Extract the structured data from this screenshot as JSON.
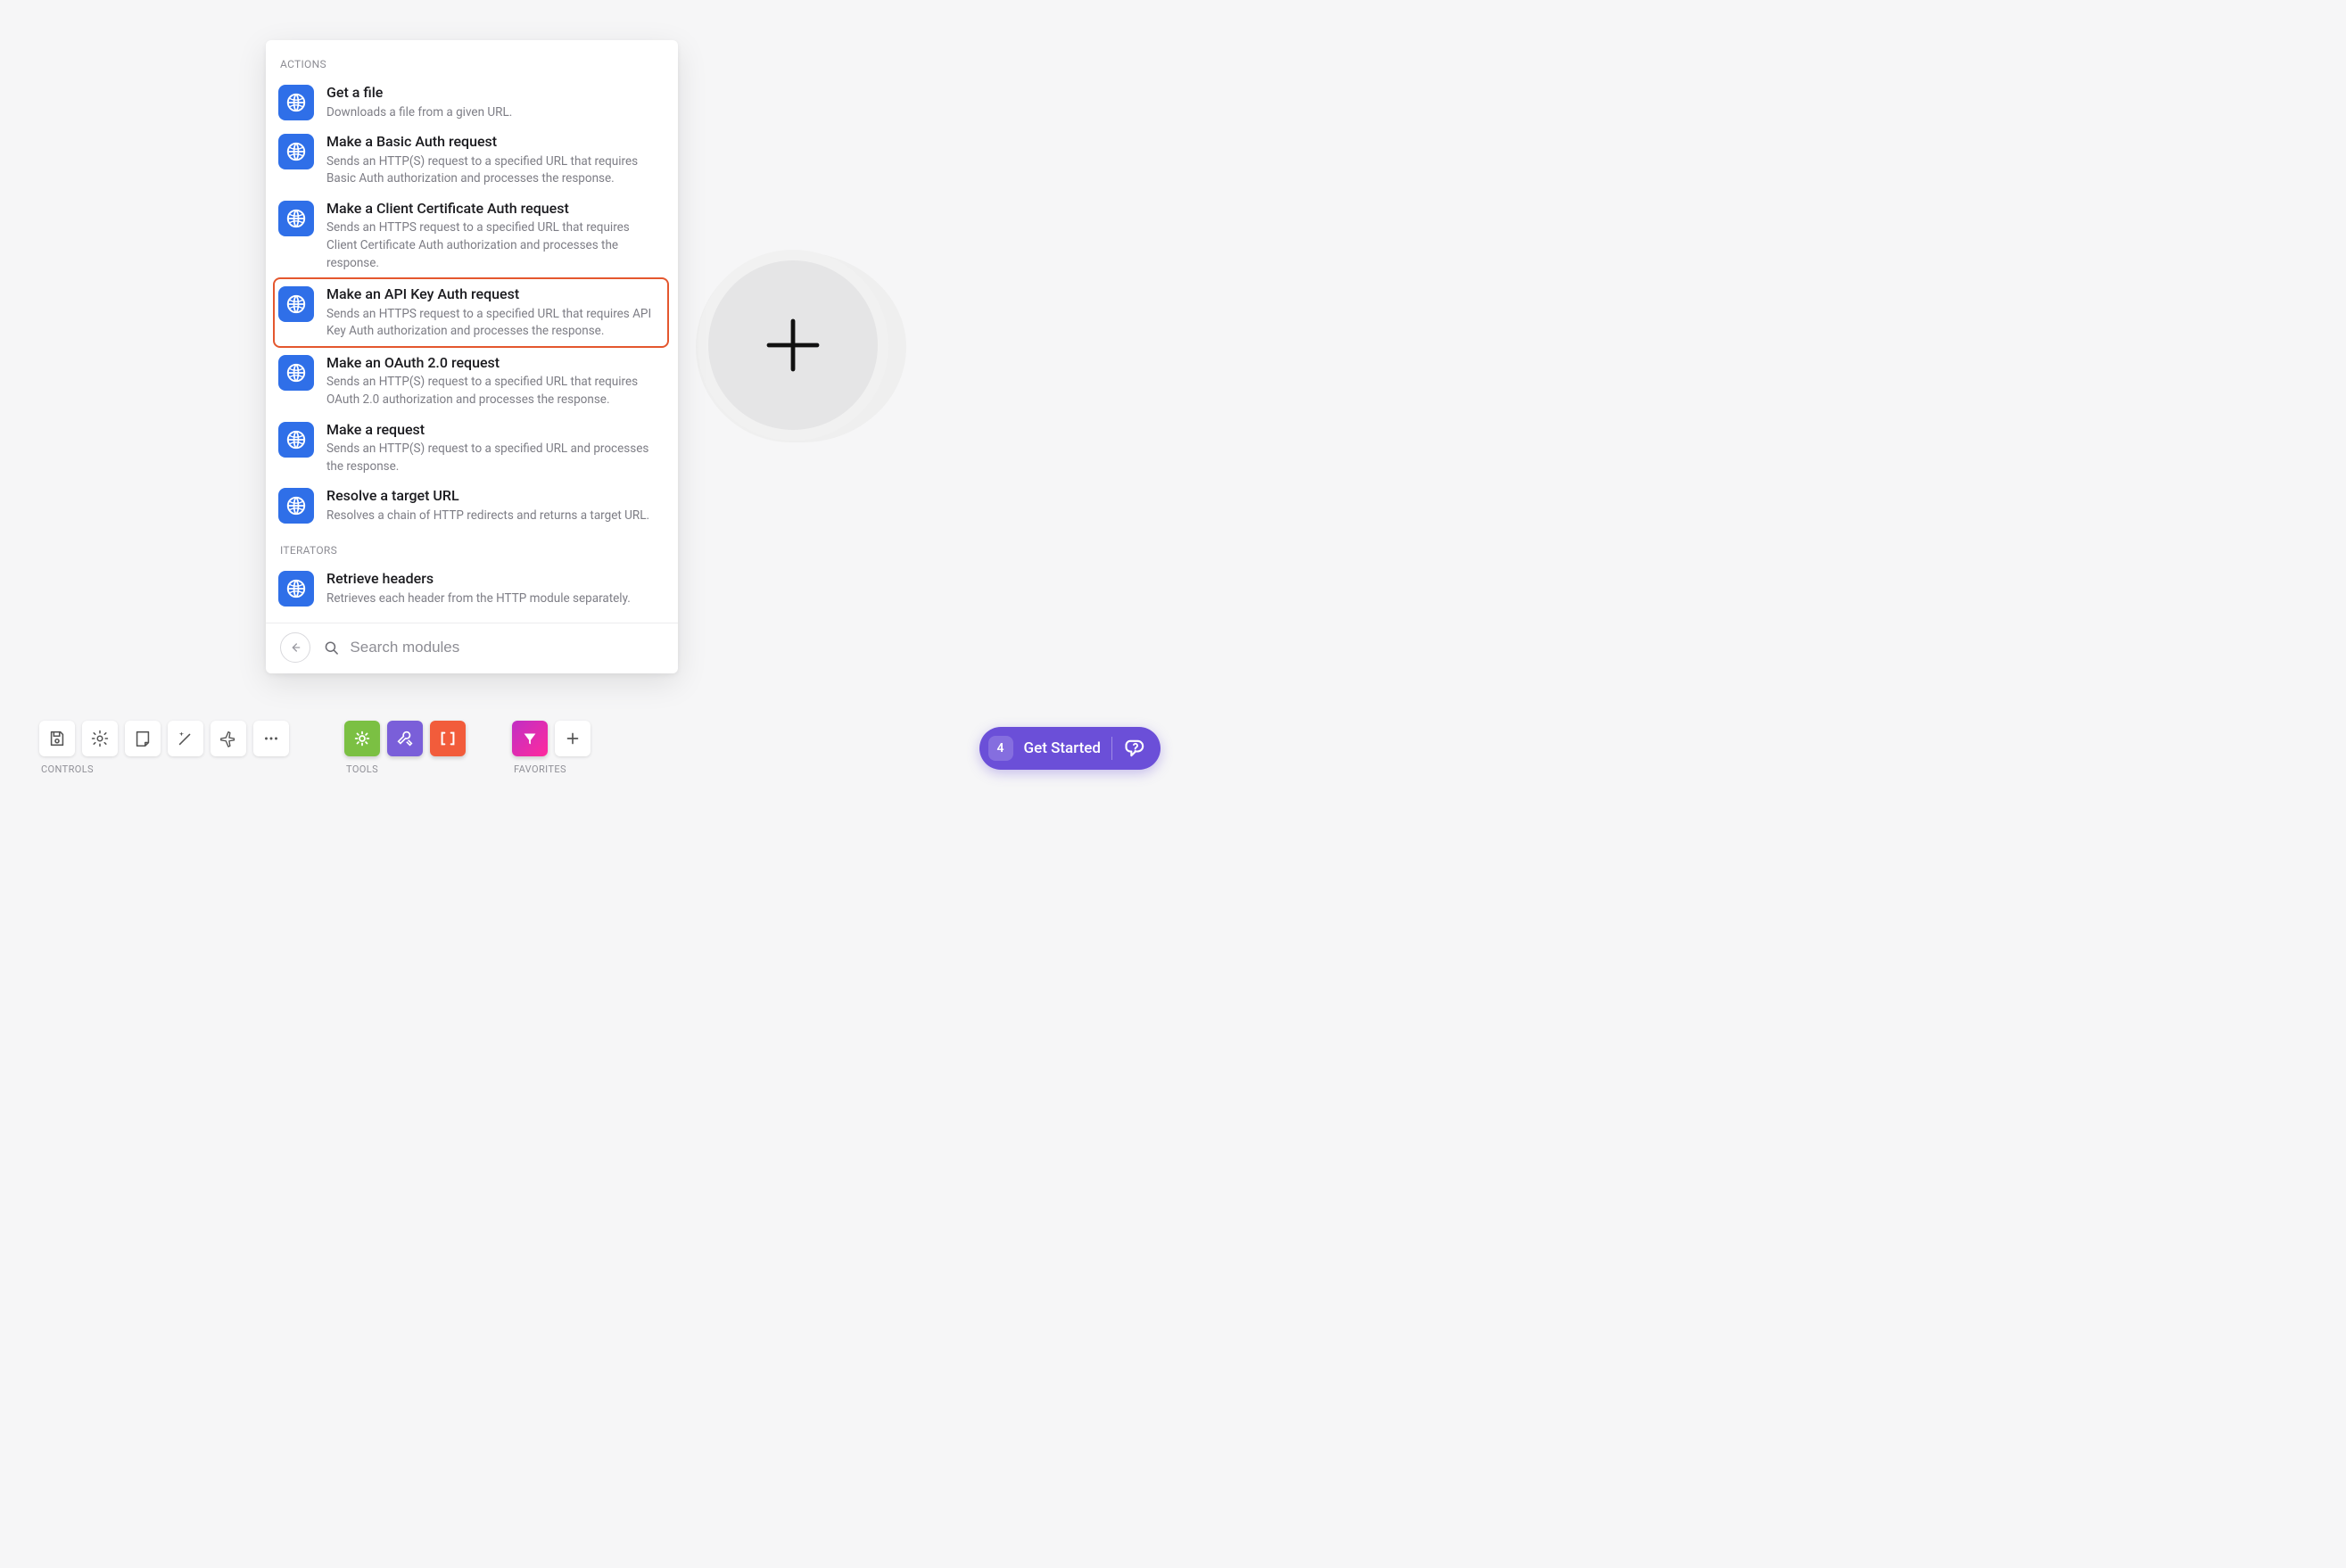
{
  "panel": {
    "sections": [
      {
        "header": "ACTIONS",
        "items": [
          {
            "title": "Get a file",
            "desc": "Downloads a file from a given URL.",
            "name": "action-get-a-file",
            "highlight": false
          },
          {
            "title": "Make a Basic Auth request",
            "desc": "Sends an HTTP(S) request to a specified URL that requires Basic Auth authorization and processes the response.",
            "name": "action-basic-auth-request",
            "highlight": false
          },
          {
            "title": "Make a Client Certificate Auth request",
            "desc": "Sends an HTTPS request to a specified URL that requires Client Certificate Auth authorization and processes the response.",
            "name": "action-client-cert-auth-request",
            "highlight": false
          },
          {
            "title": "Make an API Key Auth request",
            "desc": "Sends an HTTPS request to a specified URL that requires API Key Auth authorization and processes the response.",
            "name": "action-api-key-auth-request",
            "highlight": true
          },
          {
            "title": "Make an OAuth 2.0 request",
            "desc": "Sends an HTTP(S) request to a specified URL that requires OAuth 2.0 authorization and processes the response.",
            "name": "action-oauth2-request",
            "highlight": false
          },
          {
            "title": "Make a request",
            "desc": "Sends an HTTP(S) request to a specified URL and processes the response.",
            "name": "action-make-request",
            "highlight": false
          },
          {
            "title": "Resolve a target URL",
            "desc": "Resolves a chain of HTTP redirects and returns a target URL.",
            "name": "action-resolve-target-url",
            "highlight": false
          }
        ]
      },
      {
        "header": "ITERATORS",
        "items": [
          {
            "title": "Retrieve headers",
            "desc": "Retrieves each header from the HTTP module separately.",
            "name": "iterator-retrieve-headers",
            "highlight": false
          }
        ]
      }
    ],
    "search_placeholder": "Search modules"
  },
  "toolbars": {
    "controls_label": "CONTROLS",
    "tools_label": "TOOLS",
    "favorites_label": "FAVORITES"
  },
  "get_started": {
    "badge": "4",
    "label": "Get Started"
  }
}
